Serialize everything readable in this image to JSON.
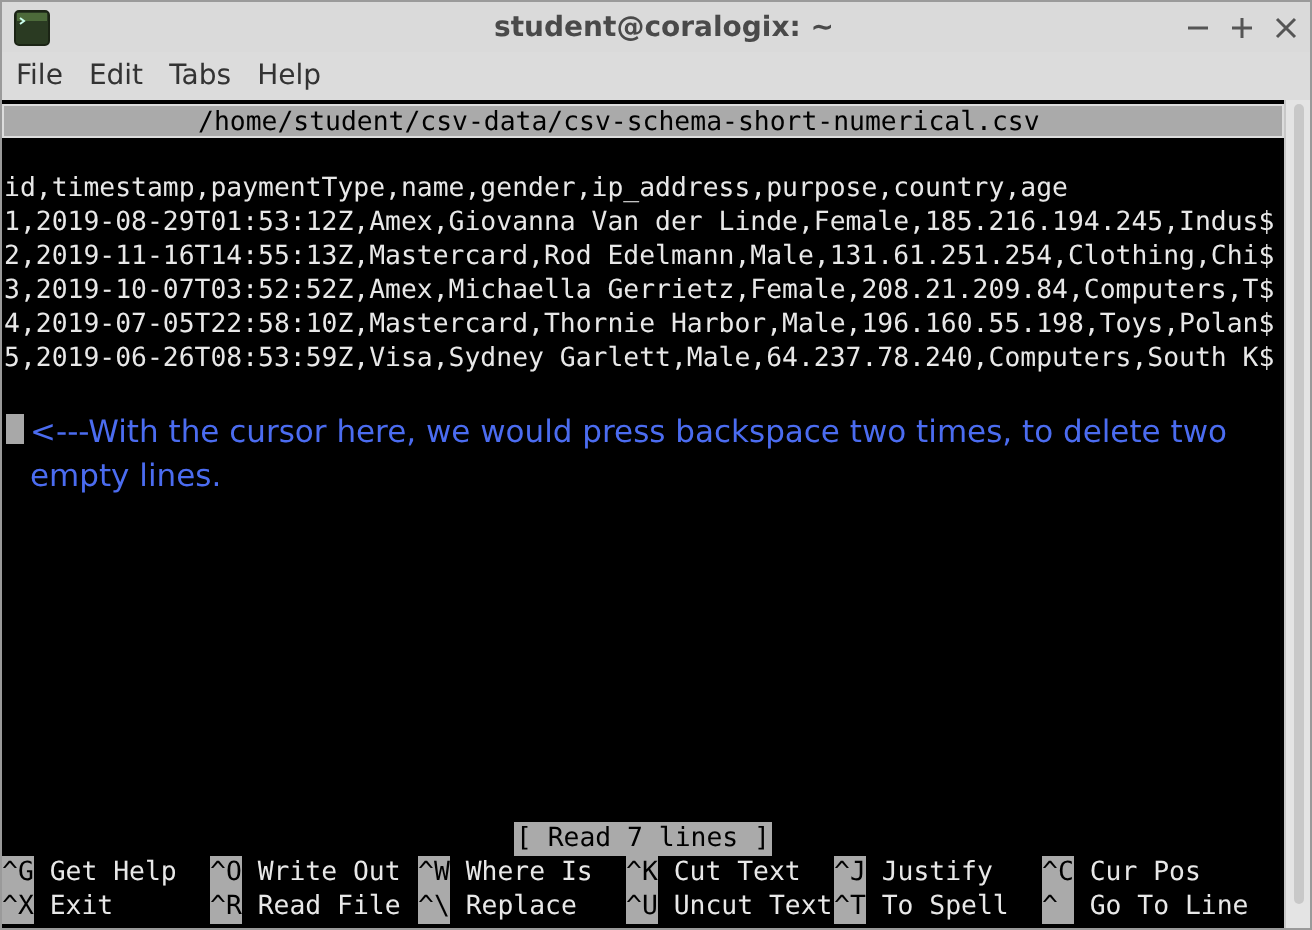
{
  "window": {
    "title": "student@coralogix: ~"
  },
  "menu": [
    "File",
    "Edit",
    "Tabs",
    "Help"
  ],
  "nano": {
    "header": "/home/student/csv-data/csv-schema-short-numerical.csv",
    "lines": [
      "id,timestamp,paymentType,name,gender,ip_address,purpose,country,age",
      "1,2019-08-29T01:53:12Z,Amex,Giovanna Van der Linde,Female,185.216.194.245,Indus$",
      "2,2019-11-16T14:55:13Z,Mastercard,Rod Edelmann,Male,131.61.251.254,Clothing,Chi$",
      "3,2019-10-07T03:52:52Z,Amex,Michaella Gerrietz,Female,208.21.209.84,Computers,T$",
      "4,2019-07-05T22:58:10Z,Mastercard,Thornie Harbor,Male,196.160.55.198,Toys,Polan$",
      "5,2019-06-26T08:53:59Z,Visa,Sydney Garlett,Male,64.237.78.240,Computers,South K$"
    ],
    "annotation": "<---With the cursor here, we would press backspace two times, to delete two empty lines.",
    "status": "[ Read 7 lines ]",
    "shortcuts": [
      [
        {
          "key": "^G",
          "label": "Get Help"
        },
        {
          "key": "^X",
          "label": "Exit"
        }
      ],
      [
        {
          "key": "^O",
          "label": "Write Out"
        },
        {
          "key": "^R",
          "label": "Read File"
        }
      ],
      [
        {
          "key": "^W",
          "label": "Where Is"
        },
        {
          "key": "^\\",
          "label": "Replace"
        }
      ],
      [
        {
          "key": "^K",
          "label": "Cut Text"
        },
        {
          "key": "^U",
          "label": "Uncut Text"
        }
      ],
      [
        {
          "key": "^J",
          "label": "Justify"
        },
        {
          "key": "^T",
          "label": "To Spell"
        }
      ],
      [
        {
          "key": "^C",
          "label": "Cur Pos"
        },
        {
          "key": "^",
          "label": "Go To Line"
        }
      ]
    ]
  }
}
